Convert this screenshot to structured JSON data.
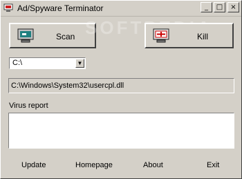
{
  "window": {
    "title": "Ad/Spyware Terminator"
  },
  "titlebar": {
    "minimize": "_",
    "maximize": "□",
    "close": "×"
  },
  "buttons": {
    "scan": "Scan",
    "kill": "Kill"
  },
  "drive": {
    "selected": "C:\\"
  },
  "path": {
    "value": "C:\\Windows\\System32\\usercpl.dll"
  },
  "report": {
    "label": "Virus report",
    "content": ""
  },
  "footer": {
    "update": "Update",
    "homepage": "Homepage",
    "about": "About",
    "exit": "Exit"
  },
  "icons": {
    "app": "app-icon",
    "scan": "monitor-scan-icon",
    "kill": "monitor-kill-icon"
  },
  "watermark": "SOFTPEDIA",
  "colors": {
    "face": "#d4d0c8",
    "kill_accent": "#cc0000",
    "scan_accent": "#208080"
  }
}
